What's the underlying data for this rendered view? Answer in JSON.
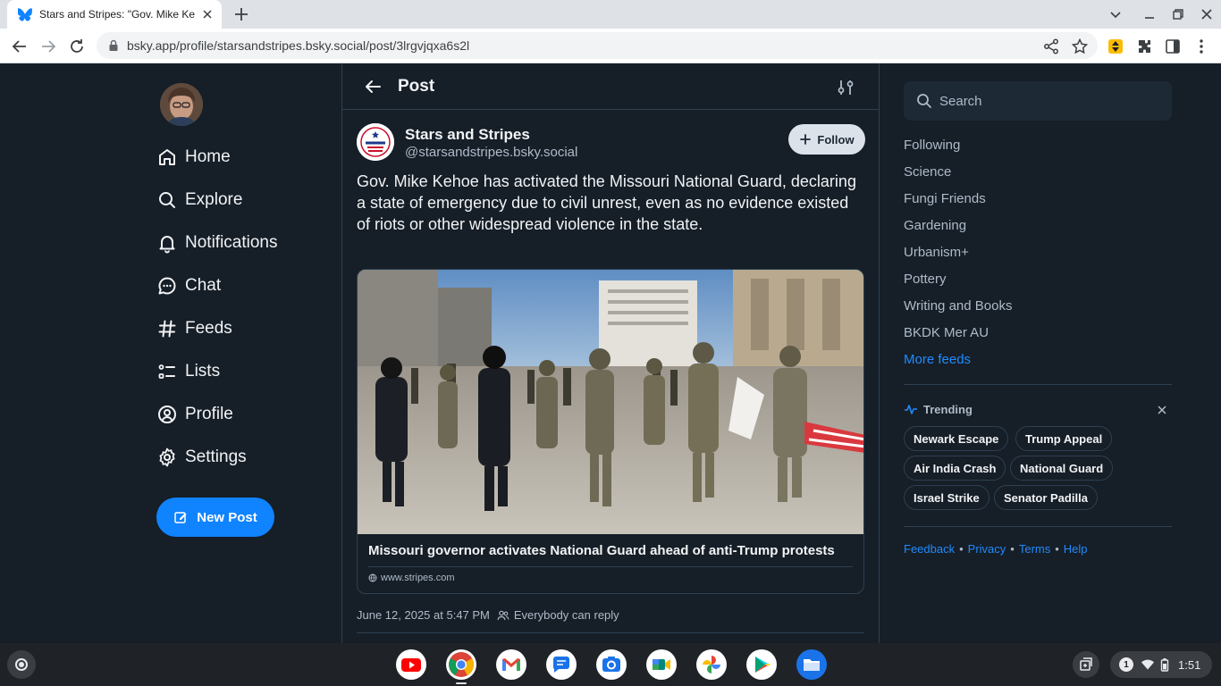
{
  "browser": {
    "tab_title": "Stars and Stripes: \"Gov. Mike Kehoe has activated the Missouri National Guard",
    "url": "bsky.app/profile/starsandstripes.bsky.social/post/3lrgvjqxa6s2l"
  },
  "nav": {
    "home": "Home",
    "explore": "Explore",
    "notifications": "Notifications",
    "chat": "Chat",
    "feeds": "Feeds",
    "lists": "Lists",
    "profile": "Profile",
    "settings": "Settings",
    "new_post": "New Post"
  },
  "header": {
    "title": "Post"
  },
  "post": {
    "author_name": "Stars and Stripes",
    "author_handle": "@starsandstripes.bsky.social",
    "follow_label": "Follow",
    "text": "Gov. Mike Kehoe has activated the Missouri National Guard, declaring a state of emergency due to civil unrest, even as no evidence existed of riots or other widespread violence in the state.",
    "embed": {
      "title": "Missouri governor activates National Guard ahead of anti-Trump protests",
      "domain": "www.stripes.com"
    },
    "timestamp": "June 12, 2025 at 5:47 PM",
    "reply_setting": "Everybody can reply"
  },
  "right": {
    "search_placeholder": "Search",
    "feeds": [
      "Following",
      "Science",
      "Fungi Friends",
      "Gardening",
      "Urbanism+",
      "Pottery",
      "Writing and Books",
      "BKDK Mer AU"
    ],
    "more_feeds": "More feeds",
    "trending_label": "Trending",
    "trending": [
      "Newark Escape",
      "Trump Appeal",
      "Air India Crash",
      "National Guard",
      "Israel Strike",
      "Senator Padilla"
    ],
    "footer": [
      "Feedback",
      "Privacy",
      "Terms",
      "Help"
    ]
  },
  "shelf": {
    "notification_count": "1",
    "clock": "1:51"
  },
  "colors": {
    "background": "#161e27",
    "accent": "#1083fe",
    "link": "#208bfe",
    "text_primary": "#f1f3f5",
    "text_secondary": "#aebbc9",
    "border": "#2e4052"
  }
}
